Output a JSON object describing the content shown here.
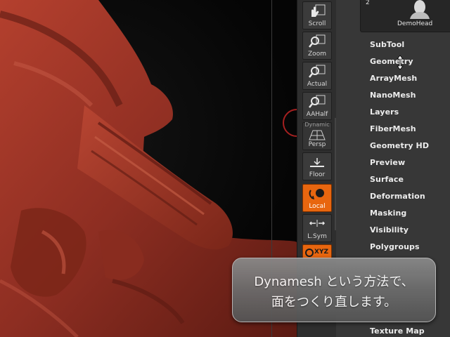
{
  "shelf": {
    "buttons": [
      {
        "label": "Scroll",
        "icon": "hand-scroll-icon"
      },
      {
        "label": "Zoom",
        "icon": "magnifier-zoom-icon"
      },
      {
        "label": "Actual",
        "icon": "magnifier-actual-icon"
      },
      {
        "label": "AAHalf",
        "icon": "magnifier-aahalf-icon"
      },
      {
        "label": "Persp",
        "icon": "perspective-grid-icon",
        "tag": "Dynamic"
      },
      {
        "label": "Floor",
        "icon": "floor-icon"
      },
      {
        "label": "Local",
        "icon": "local-rotate-icon",
        "active": true
      },
      {
        "label": "L.Sym",
        "icon": "local-symmetry-icon"
      },
      {
        "label": "XYZ",
        "icon": "xyz-rotate-icon",
        "active": true
      }
    ]
  },
  "tool_panel": {
    "thumbnail": {
      "count": "2",
      "label": "DemoHead",
      "icon": "demo-head-icon"
    },
    "menu": [
      "SubTool",
      "Geometry",
      "ArrayMesh",
      "NanoMesh",
      "Layers",
      "FiberMesh",
      "Geometry HD",
      "Preview",
      "Surface",
      "Deformation",
      "Masking",
      "Visibility",
      "Polygroups",
      "Texture Map"
    ]
  },
  "caption": {
    "line1": "Dynamesh という方法で、",
    "line2": "面をつくり直します。"
  },
  "colors": {
    "model": "#9a3426",
    "accent_orange": "#e8660f",
    "panel_bg": "#373737"
  }
}
